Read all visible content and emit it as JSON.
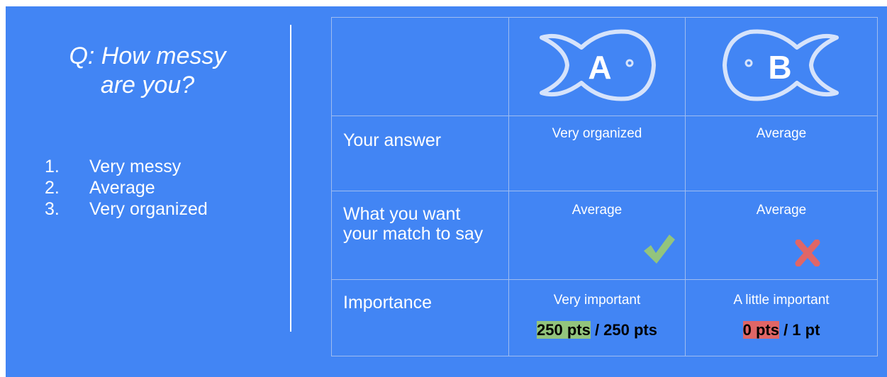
{
  "question": {
    "line1": "Q: How messy",
    "line2": "are you?"
  },
  "options": [
    {
      "num": "1.",
      "label": "Very messy"
    },
    {
      "num": "2.",
      "label": "Average"
    },
    {
      "num": "3.",
      "label": "Very organized"
    }
  ],
  "columns": [
    {
      "letter": "A",
      "icon": "fish-icon-facing-right"
    },
    {
      "letter": "B",
      "icon": "fish-icon-facing-left"
    }
  ],
  "rows": {
    "answer": {
      "label": "Your answer",
      "a": "Very organized",
      "b": "Average"
    },
    "want": {
      "label": "What you want your match to say",
      "a": "Average",
      "b": "Average",
      "a_icon": "checkmark-icon",
      "b_icon": "cross-icon"
    },
    "importance": {
      "label": "Importance",
      "a": "Very important",
      "b": "A little important",
      "a_pts": "250 pts",
      "a_total": " / 250 pts",
      "b_pts": "0 pts",
      "b_total": " / 1 pt"
    }
  },
  "colors": {
    "background": "#4285f4",
    "check": "#93c47d",
    "cross": "#e06666",
    "highlight_green": "#93c47d",
    "highlight_red": "#e06666"
  }
}
